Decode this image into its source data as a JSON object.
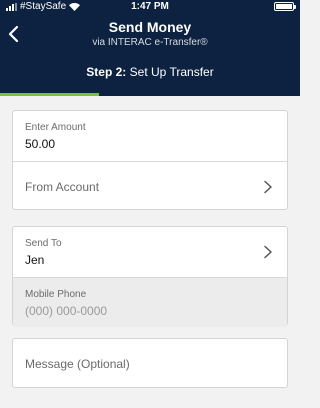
{
  "status_bar": {
    "carrier": "#StaySafe",
    "time": "1:47 PM"
  },
  "header": {
    "title": "Send Money",
    "subtitle": "via INTERAC e-Transfer®",
    "step_prefix": "Step 2:",
    "step_label": "Set Up Transfer",
    "progress_fraction": 0.33
  },
  "colors": {
    "header_bg": "#0d2240",
    "accent": "#7ac142"
  },
  "amount": {
    "label": "Enter Amount",
    "value": "50.00"
  },
  "from_account": {
    "label": "From Account"
  },
  "send_to": {
    "label": "Send To",
    "value": "Jen"
  },
  "mobile_phone": {
    "label": "Mobile Phone",
    "placeholder": "(000) 000-0000"
  },
  "message": {
    "placeholder": "Message (Optional)"
  },
  "icons": [
    "wifi-icon",
    "battery-icon",
    "back-arrow-icon",
    "chevron-right-icon"
  ]
}
